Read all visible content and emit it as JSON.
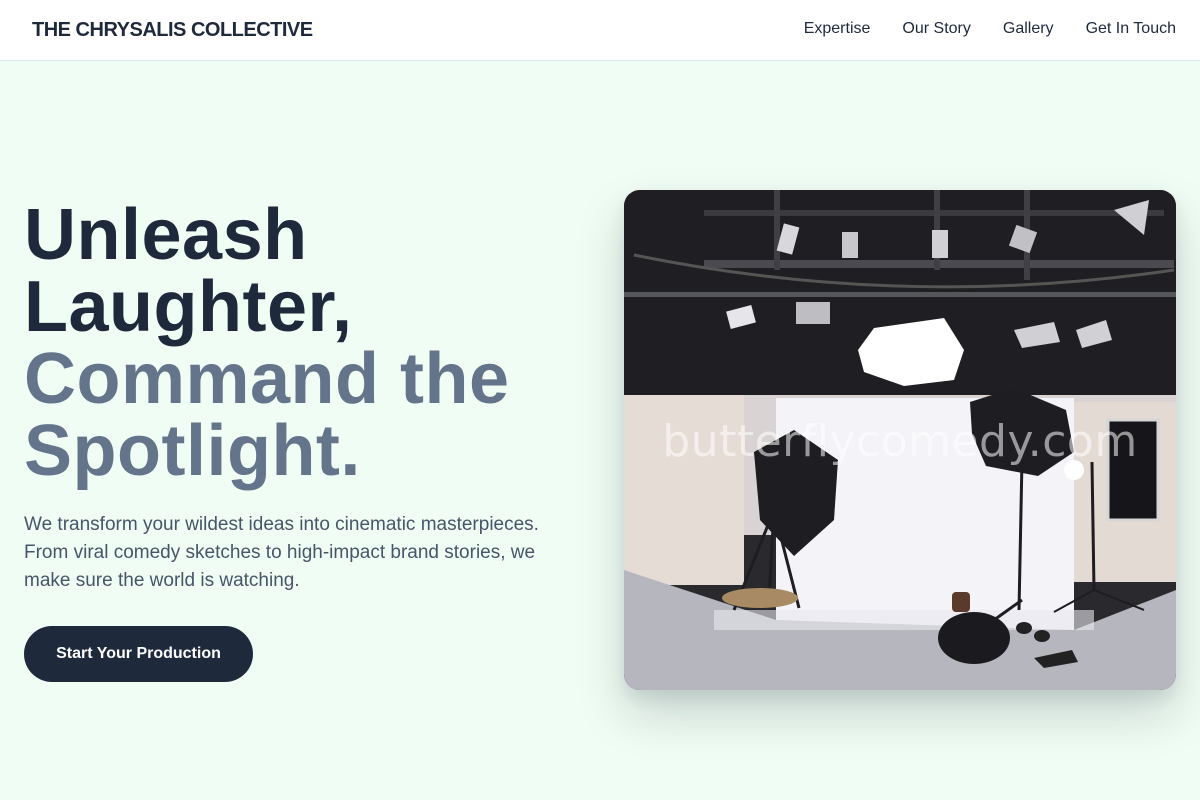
{
  "header": {
    "brand": "THE CHRYSALIS COLLECTIVE",
    "nav": [
      {
        "label": "Expertise"
      },
      {
        "label": "Our Story"
      },
      {
        "label": "Gallery"
      },
      {
        "label": "Get In Touch"
      }
    ]
  },
  "hero": {
    "title_line1": "Unleash",
    "title_line2": "Laughter,",
    "title_line3": "Command the",
    "title_line4": "Spotlight.",
    "description": "We transform your wildest ideas into cinematic masterpieces. From viral comedy sketches to high-impact brand stories, we make sure the world is watching.",
    "cta_label": "Start Your Production",
    "image_watermark": "butterflycomedy.com"
  },
  "colors": {
    "background": "#f0fdf4",
    "primary_dark": "#1e293b",
    "muted": "#64748b"
  }
}
